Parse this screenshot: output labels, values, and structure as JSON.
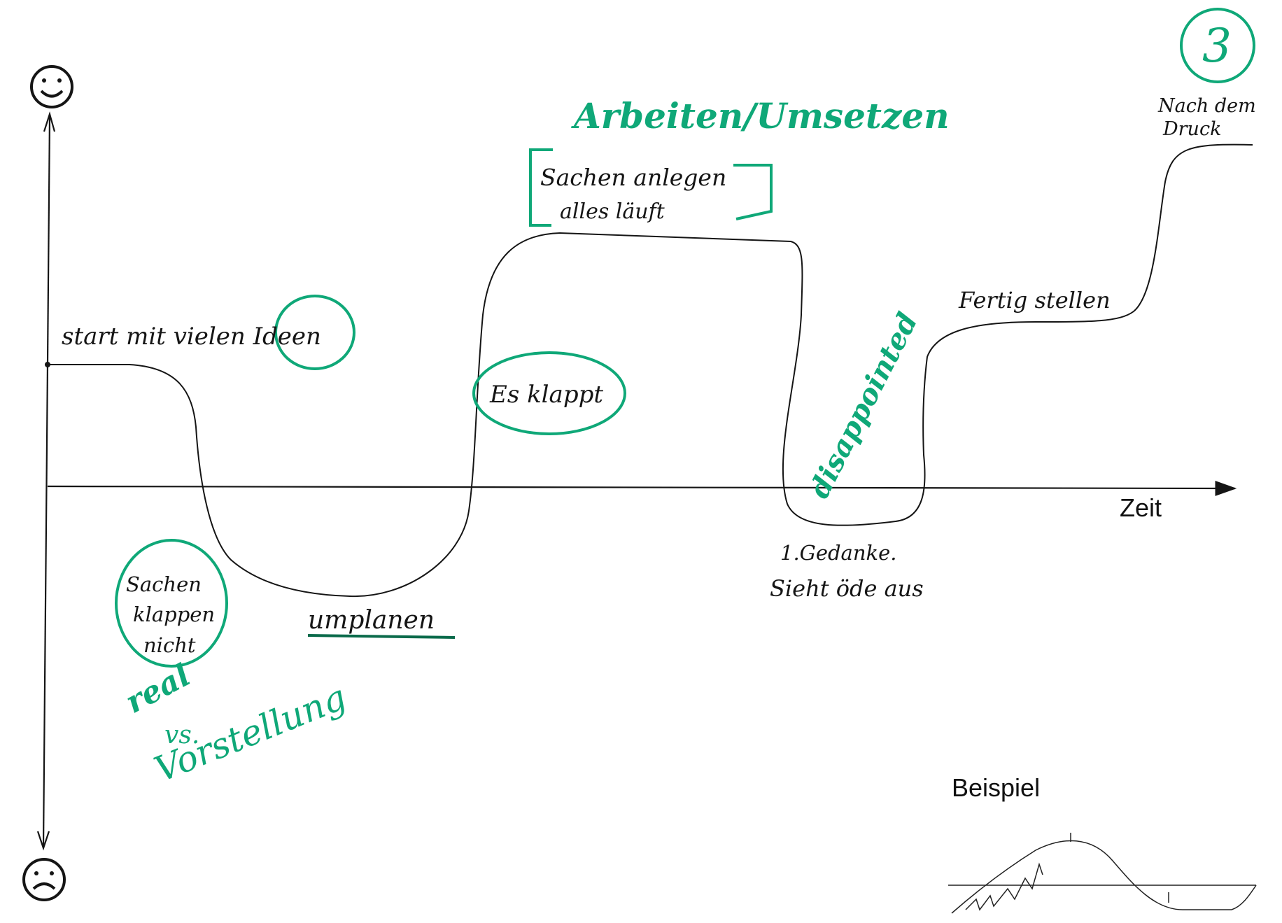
{
  "labels": {
    "axis_time": "Zeit",
    "start": "start mit vielen Ideen",
    "sachen_klappen_nicht_1": "Sachen",
    "sachen_klappen_nicht_2": "klappen",
    "sachen_klappen_nicht_3": "nicht",
    "umplanen": "umplanen",
    "es_klappt": "Es klappt",
    "sachen_anlegen_1": "Sachen anlegen",
    "sachen_anlegen_2": "alles läuft",
    "gedanke_1": "1.Gedanke.",
    "gedanke_2": "Sieht öde aus",
    "fertig_stellen": "Fertig stellen",
    "nach_druck_1": "Nach dem",
    "nach_druck_2": "Druck",
    "beispiel": "Beispiel"
  },
  "annotations": {
    "arbeiten": "Arbeiten/Umsetzen",
    "disappointed": "disappointed",
    "real": "real",
    "vs": "vs.",
    "vorstellung": "Vorstellung",
    "page_number": "3"
  },
  "icons": {
    "top": "smiley-happy-icon",
    "bottom": "smiley-sad-icon"
  },
  "colors": {
    "ink": "#151515",
    "accent_green": "#0fa878"
  }
}
